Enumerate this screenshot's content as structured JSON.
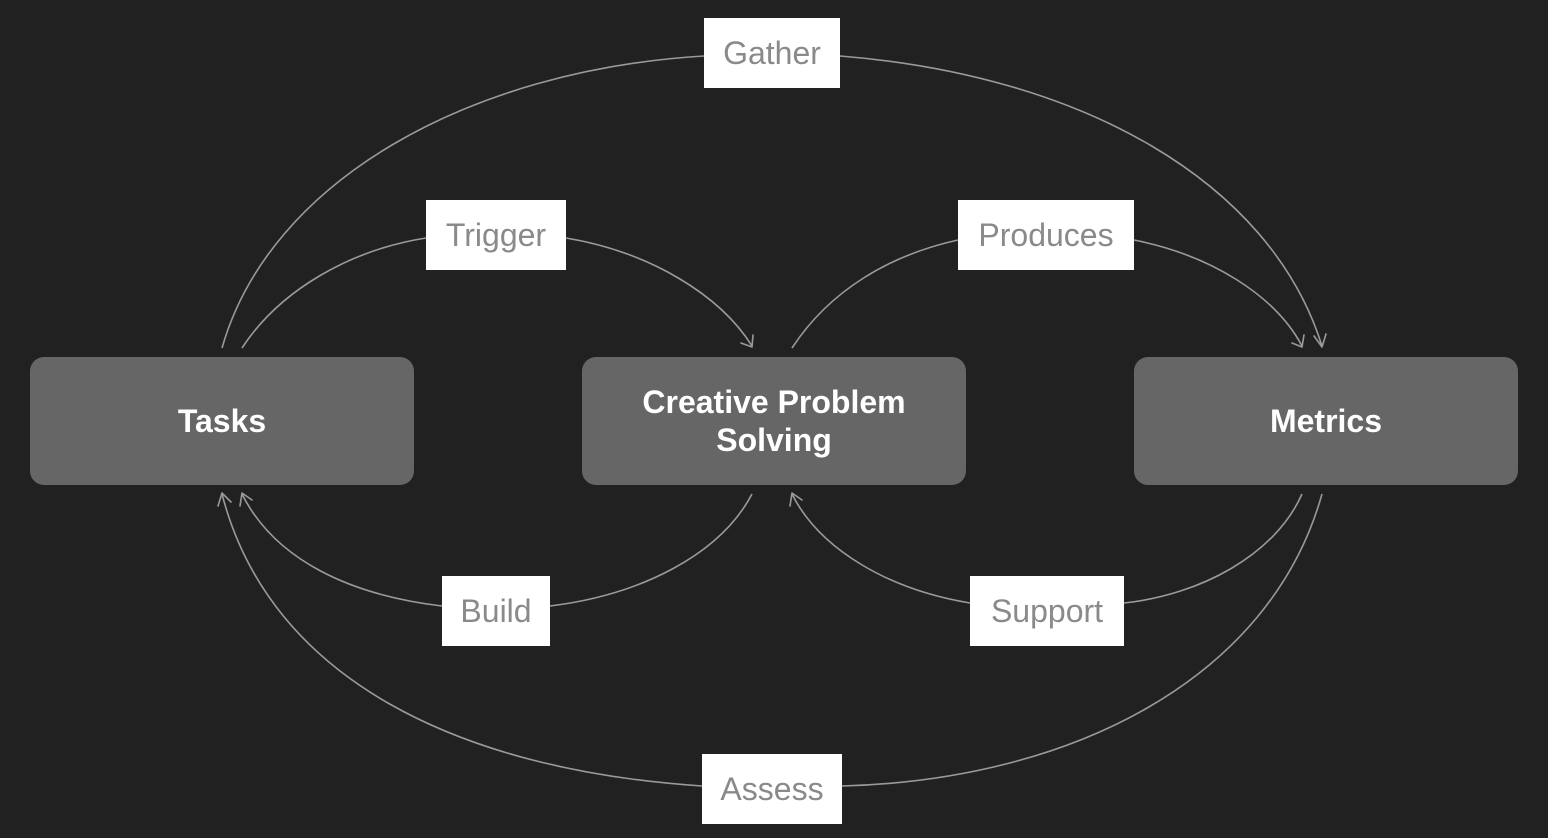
{
  "diagram": {
    "type": "cycle-flow",
    "colors": {
      "background": "#212121",
      "node_fill": "#666666",
      "node_text": "#ffffff",
      "edge": "#9a9a9a",
      "label_fill": "#ffffff",
      "label_text": "#8a8a8a"
    },
    "nodes": [
      {
        "id": "tasks",
        "label": "Tasks"
      },
      {
        "id": "cps",
        "label": "Creative Problem Solving"
      },
      {
        "id": "metrics",
        "label": "Metrics"
      }
    ],
    "edges": [
      {
        "id": "gather",
        "from": "tasks",
        "to": "metrics",
        "label": "Gather"
      },
      {
        "id": "trigger",
        "from": "tasks",
        "to": "cps",
        "label": "Trigger"
      },
      {
        "id": "produces",
        "from": "cps",
        "to": "metrics",
        "label": "Produces"
      },
      {
        "id": "build",
        "from": "cps",
        "to": "tasks",
        "label": "Build"
      },
      {
        "id": "support",
        "from": "metrics",
        "to": "cps",
        "label": "Support"
      },
      {
        "id": "assess",
        "from": "metrics",
        "to": "tasks",
        "label": "Assess"
      }
    ]
  }
}
